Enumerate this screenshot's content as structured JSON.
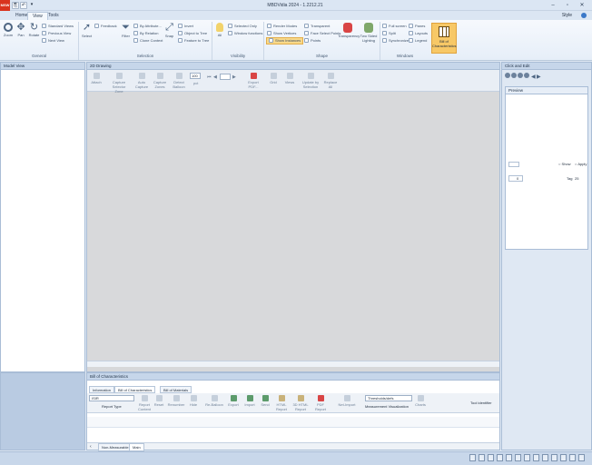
{
  "app": {
    "logo": "MSW",
    "title": "MBDVidia 2024 - 1.2212.21",
    "qat_items": [
      "⎘",
      "↶",
      "▾"
    ]
  },
  "tabs": [
    {
      "label": "Home",
      "active": false
    },
    {
      "label": "View",
      "active": true
    },
    {
      "label": "Tools",
      "active": false
    }
  ],
  "style_label": "Style",
  "ribbon": {
    "general": {
      "label": "General",
      "zoom": "Zoom",
      "pan": "Pan",
      "rotate": "Rotate",
      "standard_views": "Standard Views",
      "previous_view": "Previous View",
      "next_view": "Next View"
    },
    "selection": {
      "label": "Selection",
      "select": "Select",
      "feedback": "Feedback",
      "filter": "Filter",
      "by_attribute": "By Attribute...",
      "by_relation": "By Relation",
      "clone_context": "Clone Context",
      "snap": "Snap",
      "invert": "Invert",
      "object_to_tree": "Object to Tree",
      "feature_to_tree": "Feature to Tree"
    },
    "visibility": {
      "label": "Visibility",
      "all": "All",
      "selected_only": "Selected Only",
      "window_functions": "Window functions"
    },
    "shape": {
      "label": "Shape",
      "render_modes": "Render Modes",
      "show_vertices": "Show Vertices",
      "show_instances": "Show Instances",
      "transparent": "Transparent",
      "face_select_points": "Face Select Points",
      "points": "Points",
      "transparency": "Transparency",
      "two_sided_lighting": "Two Sided Lighting"
    },
    "windows": {
      "label": "Windows",
      "full_screen": "Full screen",
      "split": "Split",
      "synchronize": "Synchronize",
      "panes": "Panes",
      "layouts": "Layouts",
      "legend": "Legend"
    },
    "bill_of_characteristics": "Bill of Characteristics"
  },
  "model_tree": {
    "title": "Model View"
  },
  "drawing": {
    "title": "2D Drawing",
    "tools": [
      {
        "label": "Attach",
        "icon": "attach-icon"
      },
      {
        "label": "Capture Selector Zone",
        "icon": "selector-zone-icon"
      },
      {
        "label": "Auto Capture",
        "icon": "auto-capture-icon"
      },
      {
        "label": "Capture Zones",
        "icon": "capture-zones-icon"
      },
      {
        "label": "Detect Balloon",
        "icon": "detect-balloon-icon"
      }
    ],
    "zoom_value": "100",
    "zoom_unit": "pct",
    "tools2": [
      {
        "label": "Export PDF...",
        "icon": "pdf-icon"
      },
      {
        "label": "Grid",
        "icon": "grid-icon"
      },
      {
        "label": "Views",
        "icon": "views-icon"
      },
      {
        "label": "Update by Selection",
        "icon": "update-icon"
      },
      {
        "label": "Replace All",
        "icon": "replace-icon"
      }
    ]
  },
  "right_panel": {
    "title": "Click and Edit",
    "preview_title": "Preview",
    "show_label": "Show",
    "apply_label": "Apply",
    "value": "0",
    "tag_label": "Tag",
    "tag_value": "25"
  },
  "bom": {
    "title": "Bill of Characteristics",
    "subtabs": [
      {
        "label": "Information",
        "active": false
      },
      {
        "label": "Bill of Characteristics",
        "active": true
      },
      {
        "label": "Bill of Materials",
        "active": false
      }
    ],
    "report_type_value": "ISIR",
    "report_type_label": "Report Type",
    "tools": [
      {
        "label": "Report Content",
        "icon": "report-content-icon"
      },
      {
        "label": "Reset",
        "icon": "reset-icon"
      },
      {
        "label": "Renumber",
        "icon": "renumber-icon"
      },
      {
        "label": "Hide",
        "icon": "hide-icon"
      },
      {
        "label": "Re-Balloon",
        "icon": "rebaloon-icon"
      },
      {
        "label": "Export",
        "icon": "export-icon"
      },
      {
        "label": "Import",
        "icon": "import-icon"
      },
      {
        "label": "Send",
        "icon": "send-icon"
      },
      {
        "label": "HTML Report",
        "icon": "html-report-icon"
      },
      {
        "label": "3D HTML Report",
        "icon": "html3d-report-icon"
      },
      {
        "label": "PDF Report",
        "icon": "pdf-report-icon"
      },
      {
        "label": "Net-Import",
        "icon": "net-import-icon"
      }
    ],
    "measurement_value": "Thresholds/defs",
    "measurement_label": "Measurement Visualization",
    "charts_label": "Charts",
    "tool_identifier": "Tool identifier",
    "bottom_tabs": [
      "Non-Measurable",
      "Main"
    ]
  },
  "colors": {
    "logo": "#d9331e",
    "bom_button": "#f7c866",
    "panel_header": "#c6d6ea"
  }
}
